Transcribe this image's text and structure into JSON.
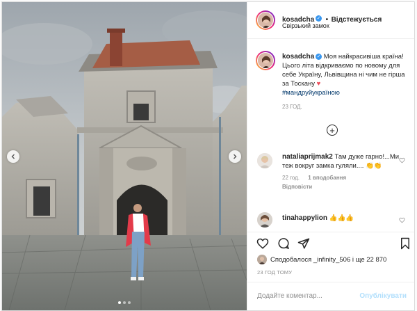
{
  "post": {
    "username": "kosadcha",
    "follow_label": "Відстежується",
    "location": "Свірзький замок",
    "caption_user": "kosadcha",
    "caption_text": "Моя найкрасивіша країна! Цього літа відкриваємо по новому для себе Україну, Львівщина ні чим не гірша за Тоскану",
    "caption_hashtag": "#мандруйукраїною",
    "caption_time": "23 год.",
    "comments": [
      {
        "user": "nataliaprijmak2",
        "text": "Там дуже гарно!...Ми теж вокруг замка гуляли....",
        "emoji": "👏👏",
        "time": "22 год.",
        "likes": "1 вподобання",
        "reply": "Відповісти"
      },
      {
        "user": "tinahappylion",
        "text": "",
        "emoji": "👍👍👍"
      }
    ],
    "likes_text": "Сподобалося _infinity_506 і ще 22 870",
    "time_ago": "23 год тому",
    "comment_placeholder": "Додайте коментар...",
    "publish_label": "Опублікувати"
  },
  "carousel": {
    "slides": 3,
    "active": 1
  },
  "colors": {
    "verified": "#3897f0",
    "hashtag": "#00376b",
    "heart": "#ed4956",
    "publish_disabled": "#b2dffc",
    "muted": "#8e8e8e"
  }
}
